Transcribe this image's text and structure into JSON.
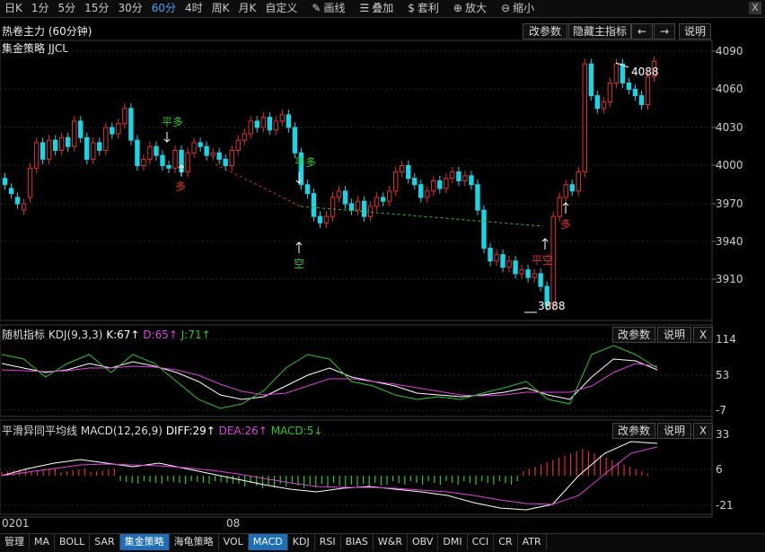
{
  "toolbar": {
    "periods": [
      "日K",
      "1分",
      "5分",
      "15分",
      "30分",
      "60分",
      "4时",
      "周K",
      "月K",
      "自定义"
    ],
    "active_period": "60分",
    "tools": [
      {
        "label": "画线",
        "icon": "pencil-icon"
      },
      {
        "label": "叠加",
        "icon": "stack-icon"
      },
      {
        "label": "套利",
        "icon": "moneybag-icon"
      },
      {
        "label": "放大",
        "icon": "zoom-in-icon"
      },
      {
        "label": "缩小",
        "icon": "zoom-out-icon"
      }
    ],
    "close": "X"
  },
  "header": {
    "title": "热卷主力 (60分钟)",
    "buttons": [
      "改参数",
      "隐藏主指标",
      "←",
      "→",
      "说明"
    ]
  },
  "main_chart": {
    "strategy_label": "集金策略 JJCL",
    "y_ticks": [
      "4090",
      "4060",
      "4030",
      "4000",
      "3970",
      "3940",
      "3910"
    ],
    "high_label": "4088",
    "low_label": "3888",
    "signals": [
      {
        "text": "平多",
        "color": "#28c828"
      },
      {
        "text": "多",
        "color": "#e03030"
      },
      {
        "text": "平多",
        "color": "#28c828"
      },
      {
        "text": "空",
        "color": "#28c828"
      },
      {
        "text": "平空",
        "color": "#e03030"
      },
      {
        "text": "多",
        "color": "#e03030"
      }
    ]
  },
  "kdj": {
    "title": "随机指标",
    "params": "KDJ(9,3,3)",
    "k": "K:67↑",
    "d": "D:65↑",
    "j": "J:71↑",
    "buttons": [
      "改参数",
      "说明",
      "X"
    ],
    "y_ticks": [
      "114",
      "53",
      "-7"
    ]
  },
  "macd": {
    "title": "平滑异同平均线",
    "params": "MACD(12,26,9)",
    "diff": "DIFF:29↑",
    "dea": "DEA:26↑",
    "macd": "MACD:5↓",
    "buttons": [
      "改参数",
      "说明",
      "X"
    ],
    "y_ticks": [
      "33",
      "6",
      "-21"
    ]
  },
  "time_axis": [
    "0201",
    "08"
  ],
  "tabs": [
    "管理",
    "MA",
    "BOLL",
    "SAR",
    "集金策略",
    "海龟策略",
    "VOL",
    "MACD",
    "KDJ",
    "RSI",
    "BIAS",
    "W&R",
    "OBV",
    "DMI",
    "CCI",
    "CR",
    "ATR"
  ],
  "active_tabs": [
    "集金策略",
    "MACD"
  ],
  "colors": {
    "up": "#e03030",
    "down": "#17d6e6",
    "k_line": "#ffffff",
    "d_line": "#e040e0",
    "j_line": "#28c828",
    "accent": "#4aa3ff"
  }
}
